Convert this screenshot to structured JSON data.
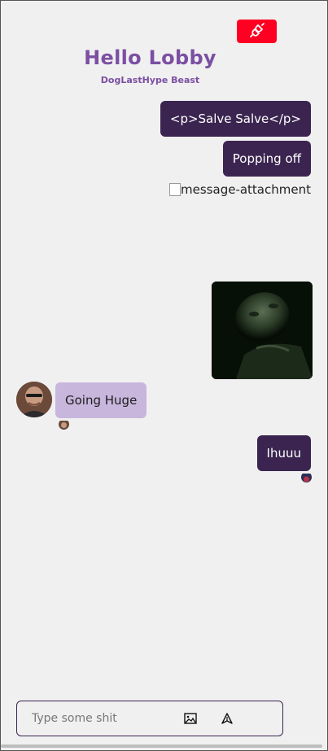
{
  "header": {
    "title": "Hello Lobby",
    "subtitle": "DogLastHype Beast",
    "disconnect_icon": "plug-disconnect-icon",
    "disconnect_color": "#ff0022"
  },
  "messages": {
    "out_1": "<p>Salve Salve</p>",
    "out_2": "Popping off",
    "attachment_alt": "message-attachment",
    "in_1": "Going Huge",
    "out_3": "Ihuuu"
  },
  "composer": {
    "placeholder": "Type some shit",
    "image_icon": "image-icon",
    "send_icon": "send-icon"
  },
  "colors": {
    "accent": "#7b4fa2",
    "outgoing_bubble": "#3b2550",
    "incoming_bubble": "#c8b6dd",
    "background": "#f0f0f0"
  }
}
